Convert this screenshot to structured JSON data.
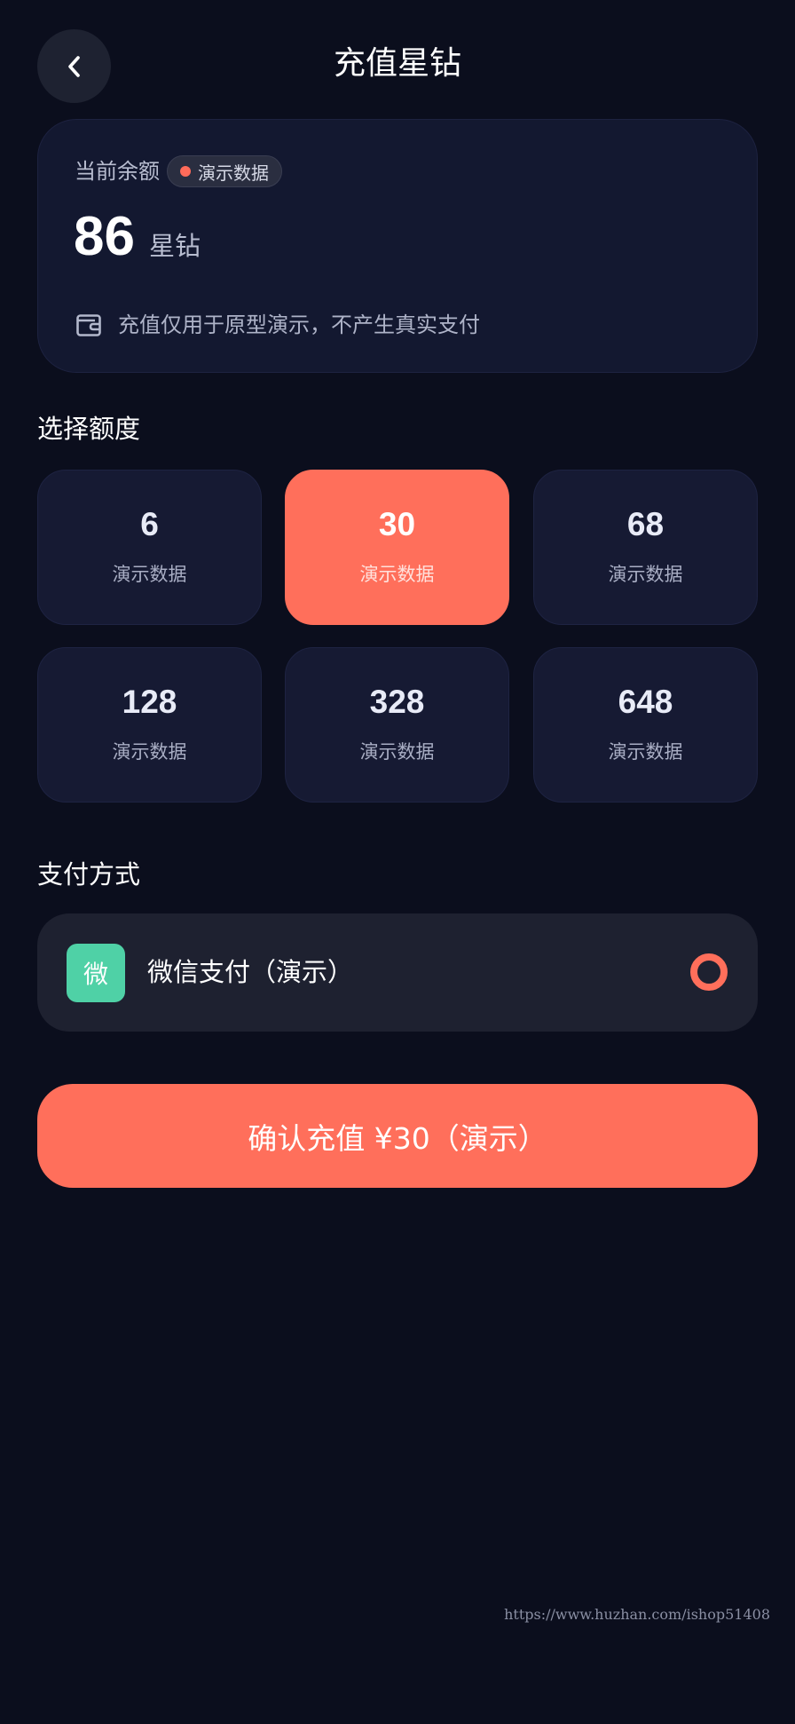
{
  "header": {
    "title": "充值星钻",
    "back_icon": "chevron-left-icon"
  },
  "balance": {
    "label": "当前余额",
    "badge": "演示数据",
    "value": "86",
    "unit": "星钻",
    "note_icon": "wallet-icon",
    "note": "充值仅用于原型演示，不产生真实支付"
  },
  "amounts": {
    "title": "选择额度",
    "items": [
      {
        "value": "6",
        "sub": "演示数据",
        "selected": false
      },
      {
        "value": "30",
        "sub": "演示数据",
        "selected": true
      },
      {
        "value": "68",
        "sub": "演示数据",
        "selected": false
      },
      {
        "value": "128",
        "sub": "演示数据",
        "selected": false
      },
      {
        "value": "328",
        "sub": "演示数据",
        "selected": false
      },
      {
        "value": "648",
        "sub": "演示数据",
        "selected": false
      }
    ]
  },
  "payment": {
    "title": "支付方式",
    "method_icon_text": "微",
    "method_label": "微信支付（演示）",
    "selected": true
  },
  "confirm": {
    "label": "确认充值 ¥30（演示）"
  },
  "watermark": "https://www.huzhan.com/ishop51408",
  "colors": {
    "background": "#0b0e1d",
    "accent": "#ff6f5b",
    "wechat": "#4fd1a6",
    "card": "#131830"
  }
}
